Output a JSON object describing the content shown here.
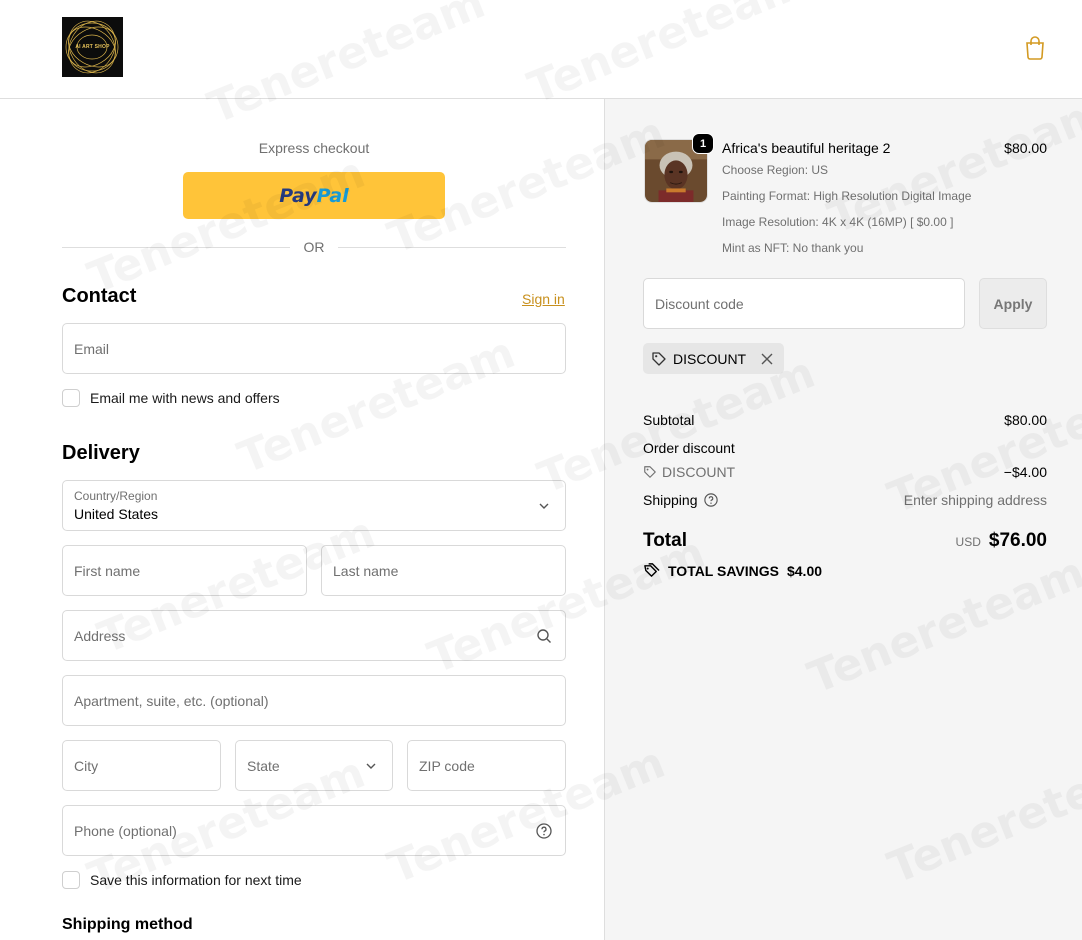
{
  "header": {
    "logo_text": "AI ART SHOP",
    "cart_icon": "shopping-bag-icon"
  },
  "express": {
    "label": "Express checkout",
    "paypal_part1": "Pay",
    "paypal_part2": "Pal",
    "or_label": "OR"
  },
  "contact": {
    "title": "Contact",
    "sign_in": "Sign in",
    "email_placeholder": "Email",
    "newsletter_label": "Email me with news and offers"
  },
  "delivery": {
    "title": "Delivery",
    "country_label": "Country/Region",
    "country_value": "United States",
    "first_name": "First name",
    "last_name": "Last name",
    "address": "Address",
    "apartment": "Apartment, suite, etc. (optional)",
    "city": "City",
    "state": "State",
    "zip": "ZIP code",
    "phone": "Phone (optional)",
    "save_info_label": "Save this information for next time"
  },
  "shipping_method": {
    "title": "Shipping method"
  },
  "order": {
    "item": {
      "quantity": "1",
      "title": "Africa's beautiful heritage 2",
      "price": "$80.00",
      "options": [
        "Choose Region: US",
        "Painting Format: High Resolution Digital Image",
        "Image Resolution: 4K x 4K (16MP) [ $0.00 ]",
        "Mint as NFT: No thank you"
      ]
    },
    "discount_placeholder": "Discount code",
    "apply_label": "Apply",
    "applied_code": "DISCOUNT",
    "subtotal_label": "Subtotal",
    "subtotal_value": "$80.00",
    "order_discount_label": "Order discount",
    "discount_code_label": "DISCOUNT",
    "discount_value": "−$4.00",
    "shipping_label": "Shipping",
    "shipping_value": "Enter shipping address",
    "total_label": "Total",
    "total_currency": "USD",
    "total_value": "$76.00",
    "savings_label": "TOTAL SAVINGS",
    "savings_value": "$4.00"
  },
  "watermark": "Tenereteam",
  "colors": {
    "paypal_yellow": "#ffc439",
    "link_gold": "#c8901d",
    "summary_bg": "#f5f5f5"
  }
}
